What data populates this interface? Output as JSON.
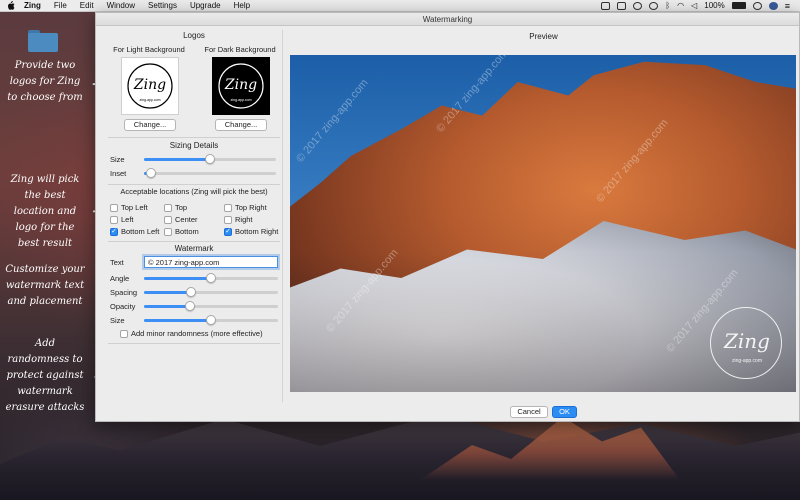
{
  "menubar": {
    "apple": "",
    "items": [
      "Zing",
      "File",
      "Edit",
      "Window",
      "Settings",
      "Upgrade",
      "Help"
    ],
    "battery": "100%",
    "battery_icon": "battery-icon",
    "status_icons": [
      "display-icon",
      "script-icon",
      "stop-icon",
      "sync-icon",
      "bluetooth-icon",
      "wifi-icon",
      "speaker-icon"
    ]
  },
  "annotations": [
    "Provide two logos for Zing to choose from",
    "Zing will pick the best location and logo for the best result",
    "Customize your watermark text and placement",
    "Add randomness to protect against watermark erasure attacks"
  ],
  "window": {
    "title": "Watermarking",
    "logos": {
      "title": "Logos",
      "light_label": "For Light Background",
      "dark_label": "For Dark Background",
      "logo_text": "Zing",
      "logo_subtext": "zing-app.com",
      "change_label": "Change..."
    },
    "sizing": {
      "title": "Sizing Details",
      "size_label": "Size",
      "size_value": 0.5,
      "inset_label": "Inset",
      "inset_value": 0.05
    },
    "locations": {
      "title": "Acceptable locations (Zing will pick the best)",
      "options": [
        {
          "label": "Top Left",
          "checked": false
        },
        {
          "label": "Top",
          "checked": false
        },
        {
          "label": "Top Right",
          "checked": false
        },
        {
          "label": "Left",
          "checked": false
        },
        {
          "label": "Center",
          "checked": false
        },
        {
          "label": "Right",
          "checked": false
        },
        {
          "label": "Bottom Left",
          "checked": true
        },
        {
          "label": "Bottom",
          "checked": false
        },
        {
          "label": "Bottom Right",
          "checked": true
        }
      ]
    },
    "watermark": {
      "title": "Watermark",
      "text_label": "Text",
      "text_value": "© 2017 zing-app.com",
      "angle_label": "Angle",
      "angle_value": 0.5,
      "spacing_label": "Spacing",
      "spacing_value": 0.35,
      "opacity_label": "Opacity",
      "opacity_value": 0.34,
      "size_label": "Size",
      "size_value": 0.5,
      "randomness_label": "Add minor randomness (more effective)",
      "randomness_checked": false
    },
    "preview": {
      "title": "Preview",
      "watermark_text": "© 2017 zing-app.com"
    },
    "buttons": {
      "cancel": "Cancel",
      "ok": "OK"
    }
  },
  "colors": {
    "accent": "#2b8cf4",
    "window_bg": "#ececec"
  }
}
